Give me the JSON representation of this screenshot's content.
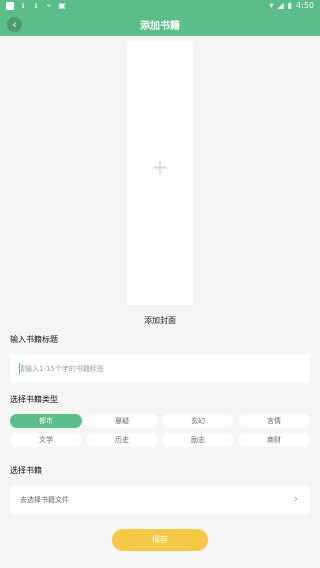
{
  "status_bar": {
    "time": "4:50",
    "icons_left": [
      "app-icon",
      "download-icon",
      "download-icon",
      "usb-icon",
      "sim-icon"
    ],
    "icons_right": [
      "wifi-icon",
      "signal-icon",
      "battery-icon"
    ]
  },
  "header": {
    "title": "添加书籍",
    "back_icon": "back-arrow-icon"
  },
  "cover": {
    "plus": "+",
    "label": "添加封面"
  },
  "book_title": {
    "label": "输入书籍标题",
    "placeholder": "请输入1-15个字的书籍标签",
    "value": ""
  },
  "genre": {
    "label": "选择书籍类型",
    "options": [
      "都市",
      "悬疑",
      "玄幻",
      "言情",
      "文学",
      "历史",
      "励志",
      "商财"
    ],
    "selected": "都市"
  },
  "file": {
    "label": "选择书籍",
    "placeholder": "去选择书籍文件",
    "chevron": "›"
  },
  "save_label": "保存",
  "colors": {
    "primary": "#5bbd89",
    "save": "#f4c948",
    "background": "#f5f5f5"
  }
}
